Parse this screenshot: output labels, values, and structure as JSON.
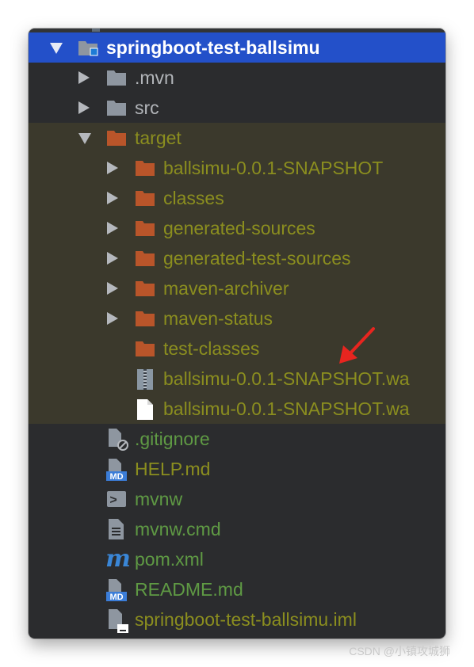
{
  "tree": {
    "root": {
      "label": "springboot-test-ballsimu",
      "expanded": true,
      "selected": true
    },
    "children": [
      {
        "label": ".mvn",
        "type": "folder",
        "expanded": false
      },
      {
        "label": "src",
        "type": "folder",
        "expanded": false
      },
      {
        "label": "target",
        "type": "excluded-folder",
        "expanded": true
      }
    ],
    "target_children": [
      {
        "label": "ballsimu-0.0.1-SNAPSHOT",
        "type": "excluded-folder",
        "expandable": true
      },
      {
        "label": "classes",
        "type": "excluded-folder",
        "expandable": true
      },
      {
        "label": "generated-sources",
        "type": "excluded-folder",
        "expandable": true
      },
      {
        "label": "generated-test-sources",
        "type": "excluded-folder",
        "expandable": true
      },
      {
        "label": "maven-archiver",
        "type": "excluded-folder",
        "expandable": true
      },
      {
        "label": "maven-status",
        "type": "excluded-folder",
        "expandable": true
      },
      {
        "label": "test-classes",
        "type": "excluded-folder",
        "expandable": false
      },
      {
        "label": "ballsimu-0.0.1-SNAPSHOT.wa",
        "type": "archive-file"
      },
      {
        "label": "ballsimu-0.0.1-SNAPSHOT.wa",
        "type": "plain-file"
      }
    ],
    "files": [
      {
        "label": ".gitignore",
        "type": "gitignore-file"
      },
      {
        "label": "HELP.md",
        "type": "markdown-file"
      },
      {
        "label": "mvnw",
        "type": "shell-file"
      },
      {
        "label": "mvnw.cmd",
        "type": "text-file"
      },
      {
        "label": "pom.xml",
        "type": "maven-file"
      },
      {
        "label": "README.md",
        "type": "markdown-file"
      },
      {
        "label": "springboot-test-ballsimu.iml",
        "type": "iml-file"
      }
    ]
  },
  "icons": {
    "md_badge": "MD",
    "maven_badge": "m",
    "shell_badge": ">"
  },
  "colors": {
    "panel_bg": "#2b2c2e",
    "selection": "#2350c9",
    "excluded_bg": "#3b392c",
    "excluded_text": "#8b8e1f",
    "added_text": "#5f9a44",
    "folder_gray": "#8e96a0",
    "folder_orange": "#b9552a",
    "annotation_arrow": "#e8251f"
  },
  "watermark": "CSDN @小镇攻城狮"
}
